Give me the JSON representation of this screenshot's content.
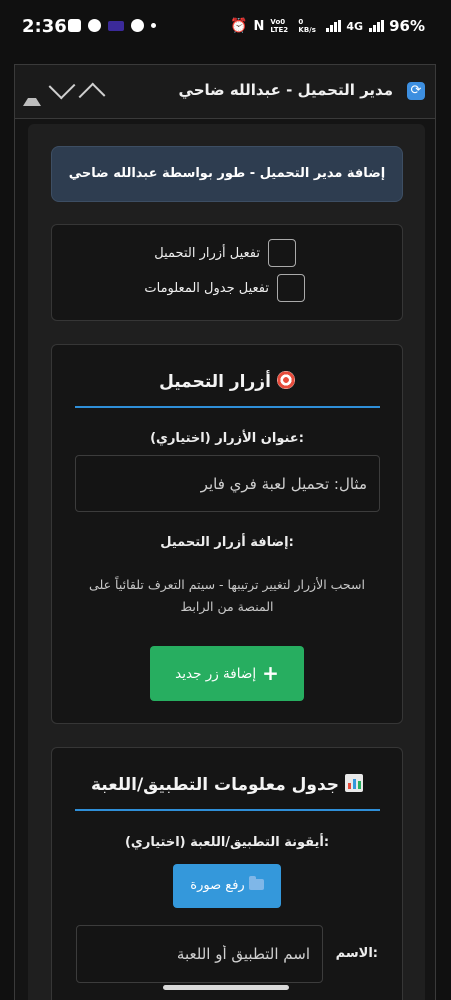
{
  "status_bar": {
    "time": "2:36",
    "battery": "96%",
    "net_speed_top": "Vo0 LTE2",
    "net_speed_bottom": "0 KB/s",
    "network": "4G"
  },
  "titlebar": {
    "title": "مدير التحميل - عبدالله ضاحي"
  },
  "banner": {
    "text": "إضافة مدير التحميل - طور بواسطة عبدالله ضاحي"
  },
  "toggles": {
    "download_buttons": "تفعيل أزرار التحميل",
    "info_table": "تفعيل جدول المعلومات"
  },
  "buttons_card": {
    "title": "أزرار التحميل",
    "title_label": "عنوان الأزرار (اختياري):",
    "title_placeholder": "مثال: تحميل لعبة فري فاير",
    "add_label": "إضافة أزرار التحميل:",
    "hint": "اسحب الأزرار لتغيير ترتيبها - سيتم التعرف تلقائياً على المنصة من الرابط",
    "add_button": "إضافة زر جديد"
  },
  "info_card": {
    "title": "جدول معلومات التطبيق/اللعبة",
    "icon_label": "أيقونة التطبيق/اللعبة (اختياري):",
    "upload_button": "رفع صورة",
    "name_label": "الاسم:",
    "name_placeholder": "اسم التطبيق أو اللعبة"
  }
}
